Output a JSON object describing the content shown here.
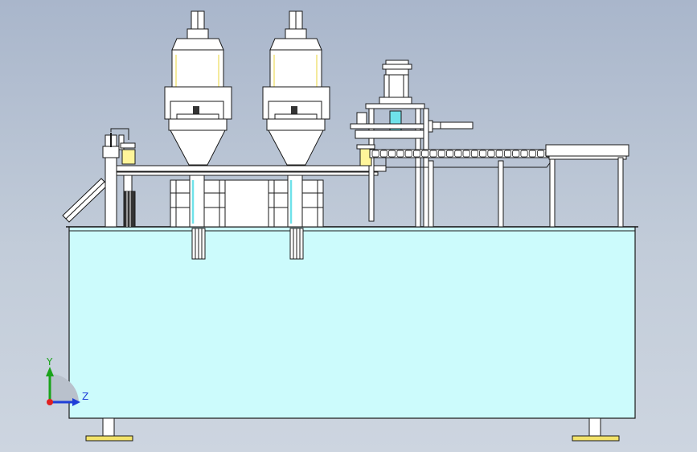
{
  "colors": {
    "background_top": "#a9b6cb",
    "background_bottom": "#cdd5e0",
    "cabinet_fill": "#ccfbfc",
    "part_fill": "#ffffff",
    "stroke": "#1a1a1a",
    "cyan_accent": "#6fe2ea",
    "yellow_accent": "#fff59a",
    "foot_yellow": "#f3e36a",
    "axis_y": "#1aa31a",
    "axis_z": "#1f3fd8",
    "axis_x": "#e02020"
  },
  "view_triad": {
    "y_label": "Y",
    "z_label": "Z"
  },
  "machine": {
    "filling_heads": 2,
    "conveyor_rollers": 22,
    "feet": 2
  }
}
